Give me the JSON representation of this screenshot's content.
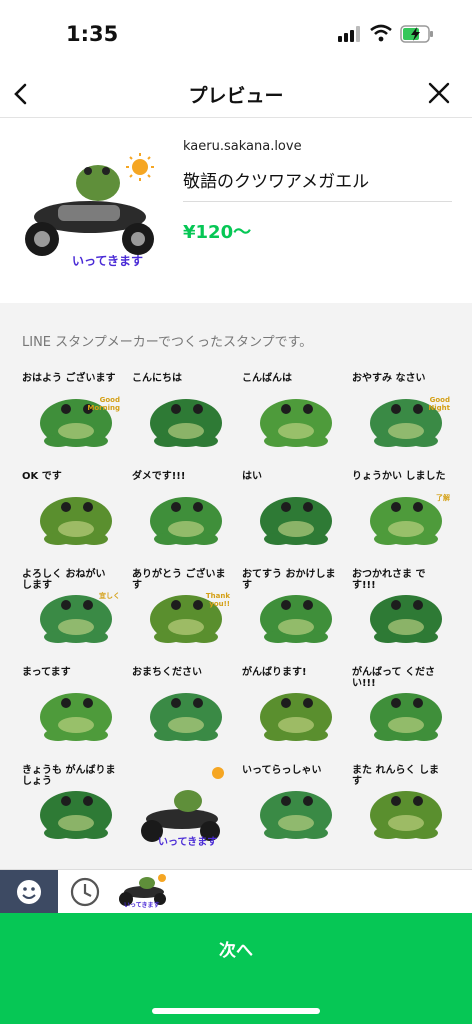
{
  "status": {
    "time": "1:35"
  },
  "header": {
    "title": "プレビュー"
  },
  "product": {
    "author": "kaeru.sakana.love",
    "name": "敬語のクツワアメガエル",
    "price": "¥120〜",
    "main_caption": "いってきます"
  },
  "note": "LINE スタンプメーカーでつくったスタンプです。",
  "stickers": [
    {
      "caption": "おはよう ございます",
      "badge": "Good Morning"
    },
    {
      "caption": "こんにちは"
    },
    {
      "caption": "こんばんは"
    },
    {
      "caption": "おやすみ なさい",
      "badge": "Good Night"
    },
    {
      "caption": "OK です"
    },
    {
      "caption": "ダメです!!!"
    },
    {
      "caption": "はい"
    },
    {
      "caption": "りょうかい しました",
      "badge": "了解"
    },
    {
      "caption": "よろしく おねがい します",
      "badge": "宜しく"
    },
    {
      "caption": "ありがとう ございます",
      "badge": "Thank you!!"
    },
    {
      "caption": "おてすう おかけします"
    },
    {
      "caption": "おつかれさま です!!!"
    },
    {
      "caption": "まってます"
    },
    {
      "caption": "おまちください"
    },
    {
      "caption": "がんばります!"
    },
    {
      "caption": "がんばって ください!!!"
    },
    {
      "caption": "きょうも がんばりましょう"
    },
    {
      "caption": "いってきます"
    },
    {
      "caption": "いってらっしゃい"
    },
    {
      "caption": "また れんらく します"
    }
  ],
  "tabbar": {
    "pack_caption": "いってきます"
  },
  "footer": {
    "next_label": "次へ"
  },
  "colors": {
    "accent": "#06c755",
    "tab_active": "#3d4a63",
    "frog": "#3f8f3a"
  }
}
